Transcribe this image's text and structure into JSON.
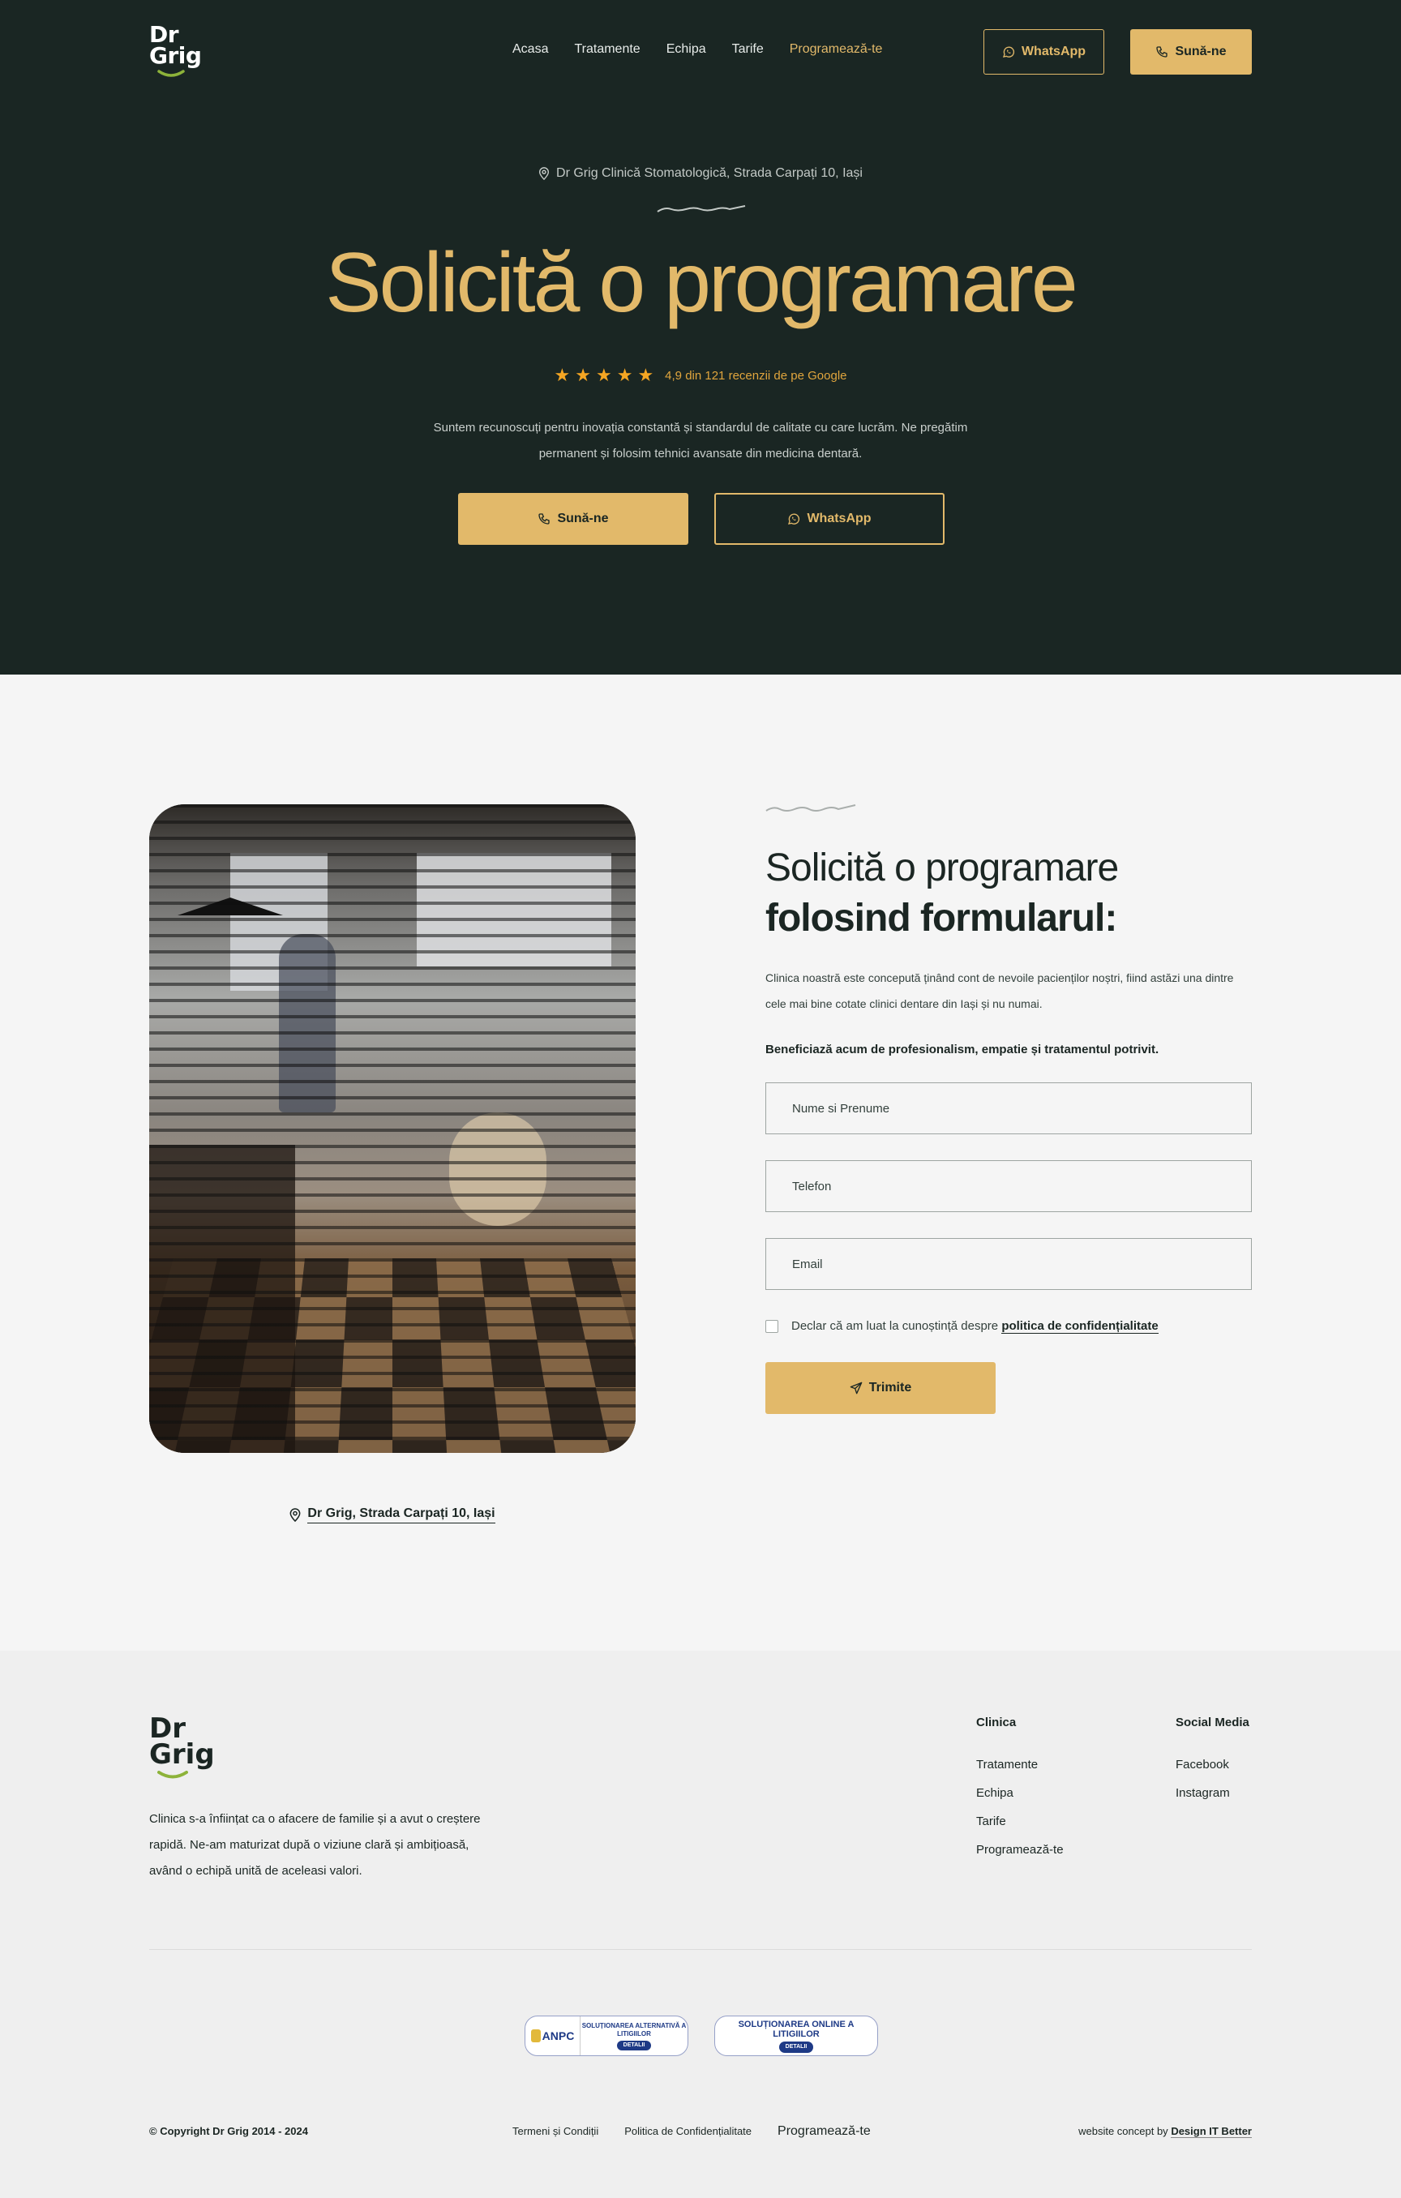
{
  "brand": {
    "logo_line1": "Dr",
    "logo_line2": "Grig"
  },
  "nav": {
    "items": [
      {
        "label": "Acasa",
        "active": false
      },
      {
        "label": "Tratamente",
        "active": false
      },
      {
        "label": "Echipa",
        "active": false
      },
      {
        "label": "Tarife",
        "active": false
      },
      {
        "label": "Programează-te",
        "active": true
      }
    ],
    "whatsapp_label": "WhatsApp",
    "call_label": "Sună-ne"
  },
  "hero": {
    "address": "Dr Grig Clinică Stomatologică, Strada Carpați 10, Iași",
    "title": "Solicită o programare",
    "rating_value": 4.9,
    "rating_stars": 5,
    "rating_text": "4,9 din 121 recenzii de pe Google",
    "description": "Suntem recunoscuți pentru inovația constantă și standardul de calitate cu care lucrăm. Ne pregătim permanent și folosim tehnici avansate din medicina dentară.",
    "call_label": "Sună-ne",
    "whatsapp_label": "WhatsApp"
  },
  "form_section": {
    "photo_alt": "Cabinet stomatologic Dr Grig",
    "photo_caption": "Dr Grig, Strada Carpați 10, Iași",
    "title_light": "Solicită o programare",
    "title_bold": "folosind formularul:",
    "description": "Clinica noastră este concepută ținând cont de nevoile pacienților noștri, fiind astăzi una dintre cele mai bine cotate clinici dentare din Iași și nu numai.",
    "highlight": "Beneficiază acum de profesionalism, empatie și tratamentul potrivit.",
    "fields": {
      "name": {
        "placeholder": "Nume si Prenume",
        "value": ""
      },
      "phone": {
        "placeholder": "Telefon",
        "value": ""
      },
      "email": {
        "placeholder": "Email",
        "value": ""
      }
    },
    "consent_text": "Declar că am luat la cunoștință despre",
    "consent_link": "politica de confidențialitate",
    "consent_checked": false,
    "submit_label": "Trimite"
  },
  "footer": {
    "description": "Clinica s-a înființat ca o afacere de familie și a avut o creștere rapidă. Ne-am maturizat după o viziune clară și ambițioasă, având o echipă unită de aceleasi valori.",
    "col_clinica": {
      "title": "Clinica",
      "links": [
        "Tratamente",
        "Echipa",
        "Tarife",
        "Programează-te"
      ]
    },
    "col_social": {
      "title": "Social Media",
      "links": [
        "Facebook",
        "Instagram"
      ]
    },
    "badge_sal": {
      "logo": "ANPC",
      "text": "SOLUȚIONAREA ALTERNATIVĂ A LITIGIILOR",
      "button": "DETALII"
    },
    "badge_sol": {
      "text": "SOLUȚIONAREA ONLINE A LITIGIILOR",
      "button": "DETALII"
    },
    "copyright": "© Copyright Dr Grig 2014 - 2024",
    "legal_links": [
      "Termeni și Condiții",
      "Politica de Confidențialitate",
      "Programează-te"
    ],
    "credit_prefix": "website concept by",
    "credit_link": "Design IT Better"
  },
  "colors": {
    "dark_bg": "#1a2623",
    "gold": "#e2b96a",
    "star": "#f5a623",
    "light_bg": "#f5f5f5",
    "footer_bg": "#efefef",
    "smile_green": "#8db33a"
  }
}
